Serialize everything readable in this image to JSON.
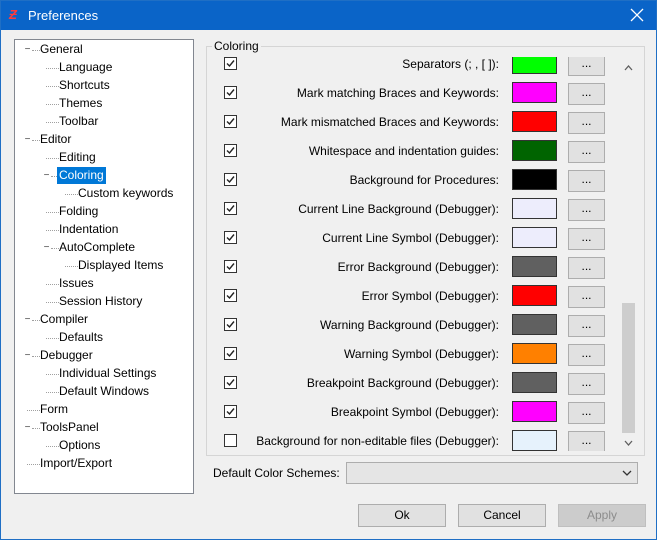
{
  "window": {
    "title": "Preferences"
  },
  "tree": {
    "items": [
      {
        "label": "General",
        "level": 0,
        "expander": "−"
      },
      {
        "label": "Language",
        "level": 1
      },
      {
        "label": "Shortcuts",
        "level": 1
      },
      {
        "label": "Themes",
        "level": 1
      },
      {
        "label": "Toolbar",
        "level": 1
      },
      {
        "label": "Editor",
        "level": 0,
        "expander": "−"
      },
      {
        "label": "Editing",
        "level": 1
      },
      {
        "label": "Coloring",
        "level": 1,
        "expander": "−",
        "selected": true
      },
      {
        "label": "Custom keywords",
        "level": 2
      },
      {
        "label": "Folding",
        "level": 1
      },
      {
        "label": "Indentation",
        "level": 1
      },
      {
        "label": "AutoComplete",
        "level": 1,
        "expander": "−"
      },
      {
        "label": "Displayed Items",
        "level": 2
      },
      {
        "label": "Issues",
        "level": 1
      },
      {
        "label": "Session History",
        "level": 1
      },
      {
        "label": "Compiler",
        "level": 0,
        "expander": "−"
      },
      {
        "label": "Defaults",
        "level": 1
      },
      {
        "label": "Debugger",
        "level": 0,
        "expander": "−"
      },
      {
        "label": "Individual Settings",
        "level": 1
      },
      {
        "label": "Default Windows",
        "level": 1
      },
      {
        "label": "Form",
        "level": 0
      },
      {
        "label": "ToolsPanel",
        "level": 0,
        "expander": "−"
      },
      {
        "label": "Options",
        "level": 1
      },
      {
        "label": "Import/Export",
        "level": 0
      }
    ]
  },
  "coloring": {
    "group_label": "Coloring",
    "dots_label": "...",
    "rows": [
      {
        "label": "Separators (; , [ ]):",
        "color": "#00ff00",
        "checked": true
      },
      {
        "label": "Mark matching Braces and Keywords:",
        "color": "#ff00ff",
        "checked": true
      },
      {
        "label": "Mark mismatched Braces and Keywords:",
        "color": "#ff0000",
        "checked": true
      },
      {
        "label": "Whitespace and indentation guides:",
        "color": "#006400",
        "checked": true
      },
      {
        "label": "Background for Procedures:",
        "color": "#000000",
        "checked": true
      },
      {
        "label": "Current Line Background (Debugger):",
        "color": "#ededfc",
        "checked": true
      },
      {
        "label": "Current Line Symbol (Debugger):",
        "color": "#ededfc",
        "checked": true
      },
      {
        "label": "Error Background (Debugger):",
        "color": "#606060",
        "checked": true
      },
      {
        "label": "Error Symbol (Debugger):",
        "color": "#ff0000",
        "checked": true
      },
      {
        "label": "Warning Background (Debugger):",
        "color": "#606060",
        "checked": true
      },
      {
        "label": "Warning Symbol (Debugger):",
        "color": "#ff8000",
        "checked": true
      },
      {
        "label": "Breakpoint Background (Debugger):",
        "color": "#606060",
        "checked": true
      },
      {
        "label": "Breakpoint Symbol (Debugger):",
        "color": "#ff00ff",
        "checked": true
      },
      {
        "label": "Background for non-editable files (Debugger):",
        "color": "#e6f2fc",
        "checked": false
      }
    ]
  },
  "schemes": {
    "label": "Default Color Schemes:",
    "value": ""
  },
  "buttons": {
    "ok": "Ok",
    "cancel": "Cancel",
    "apply": "Apply"
  }
}
